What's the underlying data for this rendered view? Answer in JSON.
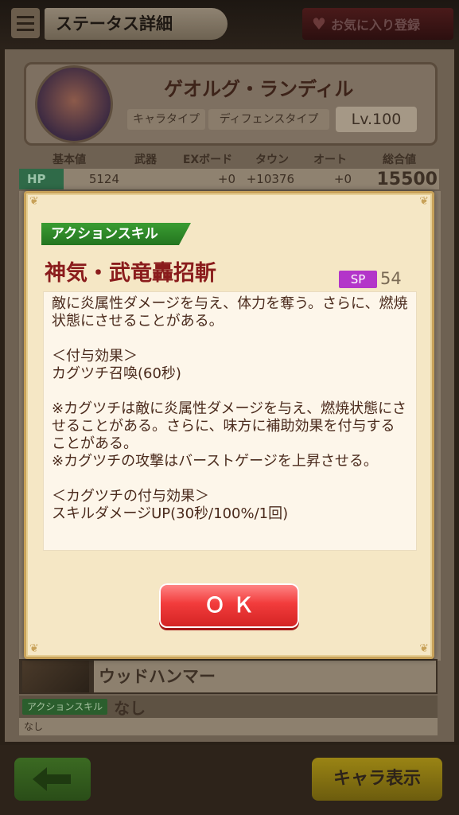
{
  "header": {
    "title": "ステータス詳細",
    "favorite_label": "お気に入り登録"
  },
  "character": {
    "name": "ゲオルグ・ランディル",
    "type_label": "キャラタイプ",
    "type_value": "ディフェンスタイプ",
    "level": "Lv.100"
  },
  "stats": {
    "headers": [
      "基本値",
      "武器",
      "EXボード",
      "タウン",
      "オート",
      "総合値"
    ],
    "hp": {
      "label": "HP",
      "base": "5124",
      "weapon": "",
      "ex_board": "+0",
      "town": "+10376",
      "auto": "+0",
      "total": "15500"
    }
  },
  "weapon": {
    "name": "ウッドハンマー"
  },
  "weapon_skill": {
    "tag": "アクションスキル",
    "value": "なし",
    "desc": "なし"
  },
  "footer": {
    "display_label": "キャラ表示"
  },
  "modal": {
    "skill_tag": "アクションスキル",
    "skill_name": "神気・武竜轟招斬",
    "sp_label": "SP",
    "sp_value": "54",
    "description": "敵に炎属性ダメージを与え、体力を奪う。さらに、燃焼状態にさせることがある。\n\n＜付与効果＞\nカグツチ召喚(60秒)\n\n※カグツチは敵に炎属性ダメージを与え、燃焼状態にさせることがある。さらに、味方に補助効果を付与することがある。\n※カグツチの攻撃はバーストゲージを上昇させる。\n\n＜カグツチの付与効果＞\nスキルダメージUP(30秒/100%/1回)",
    "ok_label": "ＯＫ"
  }
}
